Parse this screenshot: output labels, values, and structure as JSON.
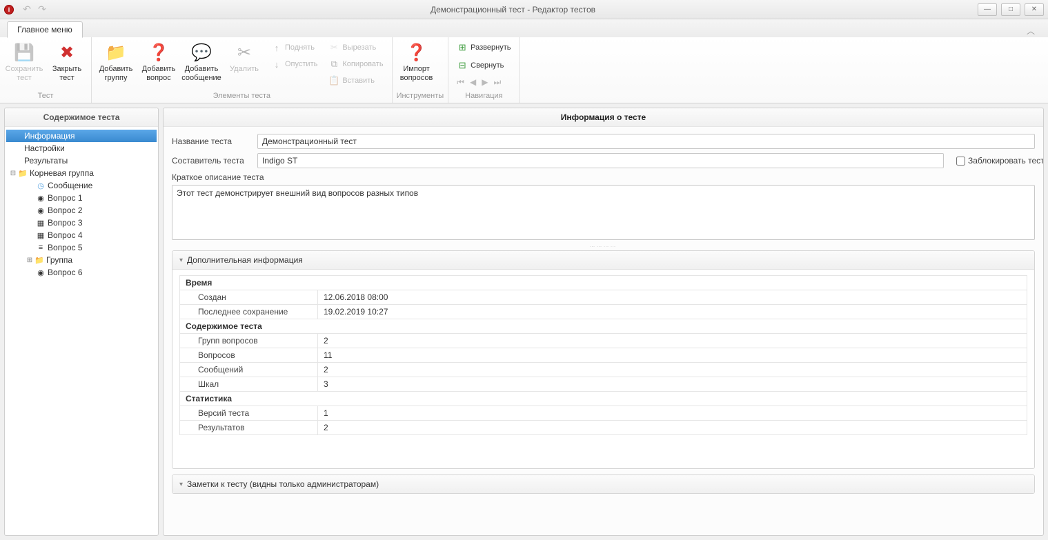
{
  "titlebar": {
    "title": "Демонстрационный тест - Редактор тестов"
  },
  "menu": {
    "main_tab": "Главное меню"
  },
  "ribbon": {
    "test": {
      "save": "Сохранить\nтест",
      "close": "Закрыть\nтест",
      "group_title": "Тест"
    },
    "elements": {
      "add_group": "Добавить\nгруппу",
      "add_question": "Добавить\nвопрос",
      "add_message": "Добавить\nсообщение",
      "delete": "Удалить",
      "up": "Поднять",
      "down": "Опустить",
      "cut": "Вырезать",
      "copy": "Копировать",
      "paste": "Вставить",
      "group_title": "Элементы теста"
    },
    "tools": {
      "import": "Импорт\nвопросов",
      "group_title": "Инструменты"
    },
    "nav": {
      "expand": "Развернуть",
      "collapse": "Свернуть",
      "group_title": "Навигация"
    }
  },
  "left": {
    "title": "Содержимое теста",
    "items": {
      "info": "Информация",
      "settings": "Настройки",
      "results": "Результаты",
      "root_group": "Корневая группа",
      "msg": "Сообщение",
      "q1": "Вопрос 1",
      "q2": "Вопрос 2",
      "q3": "Вопрос 3",
      "q4": "Вопрос 4",
      "q5": "Вопрос 5",
      "group": "Группа",
      "q6": "Вопрос 6"
    }
  },
  "right": {
    "title": "Информация о тесте",
    "labels": {
      "name": "Название теста",
      "author": "Составитель теста",
      "desc": "Краткое описание теста",
      "lock": "Заблокировать тест"
    },
    "values": {
      "name": "Демонстрационный тест",
      "author": "Indigo ST",
      "desc": "Этот тест демонстрирует внешний вид вопросов разных типов"
    },
    "accordion": {
      "more_info": "Дополнительная информация",
      "notes": "Заметки к тесту (видны только администраторам)"
    },
    "info_table": {
      "sections": {
        "time": "Время",
        "content": "Содержимое теста",
        "stats": "Статистика"
      },
      "rows": {
        "created_l": "Создан",
        "created_v": "12.06.2018 08:00",
        "saved_l": "Последнее сохранение",
        "saved_v": "19.02.2019 10:27",
        "groups_l": "Групп вопросов",
        "groups_v": "2",
        "questions_l": "Вопросов",
        "questions_v": "11",
        "messages_l": "Сообщений",
        "messages_v": "2",
        "scales_l": "Шкал",
        "scales_v": "3",
        "versions_l": "Версий теста",
        "versions_v": "1",
        "results_l": "Результатов",
        "results_v": "2"
      }
    }
  }
}
